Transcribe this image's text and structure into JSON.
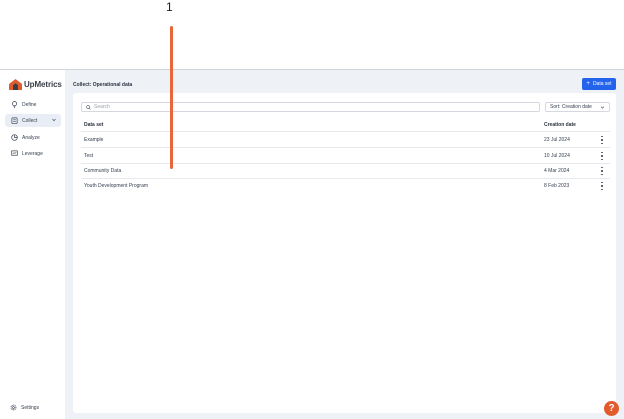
{
  "annotation": {
    "label": "1",
    "color": "#e8663a"
  },
  "app": {
    "name": "UpMetrics"
  },
  "sidebar": {
    "items": [
      {
        "label": "Define",
        "icon": "lightbulb-icon"
      },
      {
        "label": "Collect",
        "icon": "clipboard-icon",
        "active": true
      },
      {
        "label": "Analyze",
        "icon": "pie-chart-icon"
      },
      {
        "label": "Leverage",
        "icon": "presentation-icon"
      }
    ],
    "settings_label": "Settings"
  },
  "main": {
    "title": "Collect: Operational data",
    "add_button_label": "Data set",
    "search_placeholder": "Search",
    "sort_label": "Sort: Creation date",
    "columns": {
      "name": "Data set",
      "date": "Creation date"
    },
    "rows": [
      {
        "name": "Example",
        "date": "23 Jul 2024"
      },
      {
        "name": "Test",
        "date": "10 Jul 2024"
      },
      {
        "name": "Community Data",
        "date": "4 Mar 2024"
      },
      {
        "name": "Youth Development Program",
        "date": "8 Feb 2023"
      }
    ]
  },
  "help": {
    "label": "?"
  },
  "colors": {
    "accent": "#2463eb",
    "brand": "#e15b2c",
    "background": "#eef1f6"
  }
}
